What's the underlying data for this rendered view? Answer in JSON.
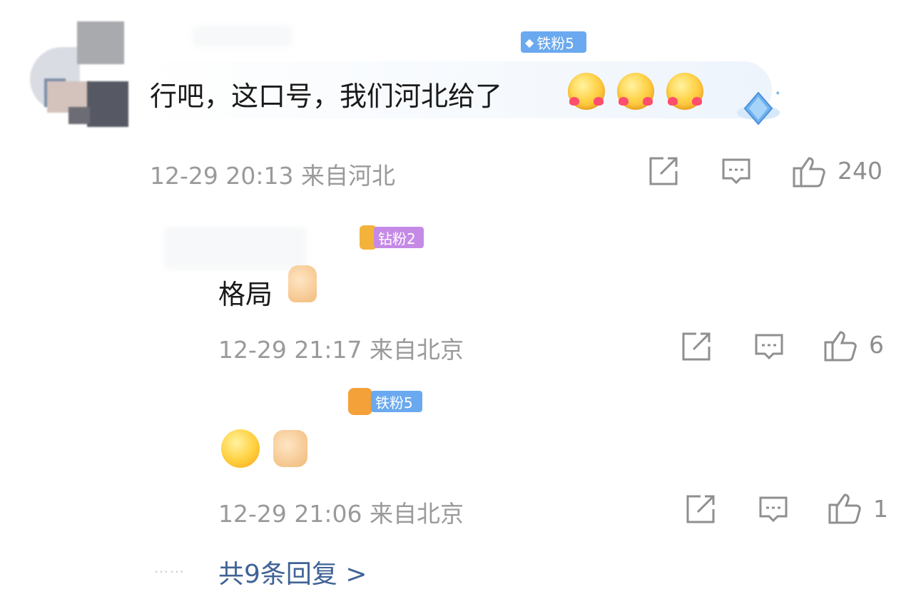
{
  "main_comment": {
    "badge": "铁粉5",
    "text": "行吧，这口号，我们河北给了",
    "emoji": "heart-eyes-blush-emoji",
    "meta": "12-29 20:13 来自河北",
    "like_count": "240"
  },
  "replies": [
    {
      "badge": "钻粉2",
      "text": "格局",
      "emoji": "thumbs-up-emoji",
      "meta": "12-29 21:17 来自北京",
      "like_count": "6"
    },
    {
      "badge": "铁粉5",
      "text": "",
      "emoji": "grin-thumbs-up-emoji",
      "meta": "12-29 21:06 来自北京",
      "like_count": "1"
    }
  ],
  "more_replies": {
    "label": "共9条回复 >",
    "dots": "……"
  },
  "colors": {
    "badge_iron": "#6aa9ef",
    "badge_diamond": "#c58ae6",
    "link": "#3f6396",
    "meta": "#9a9a9a"
  }
}
